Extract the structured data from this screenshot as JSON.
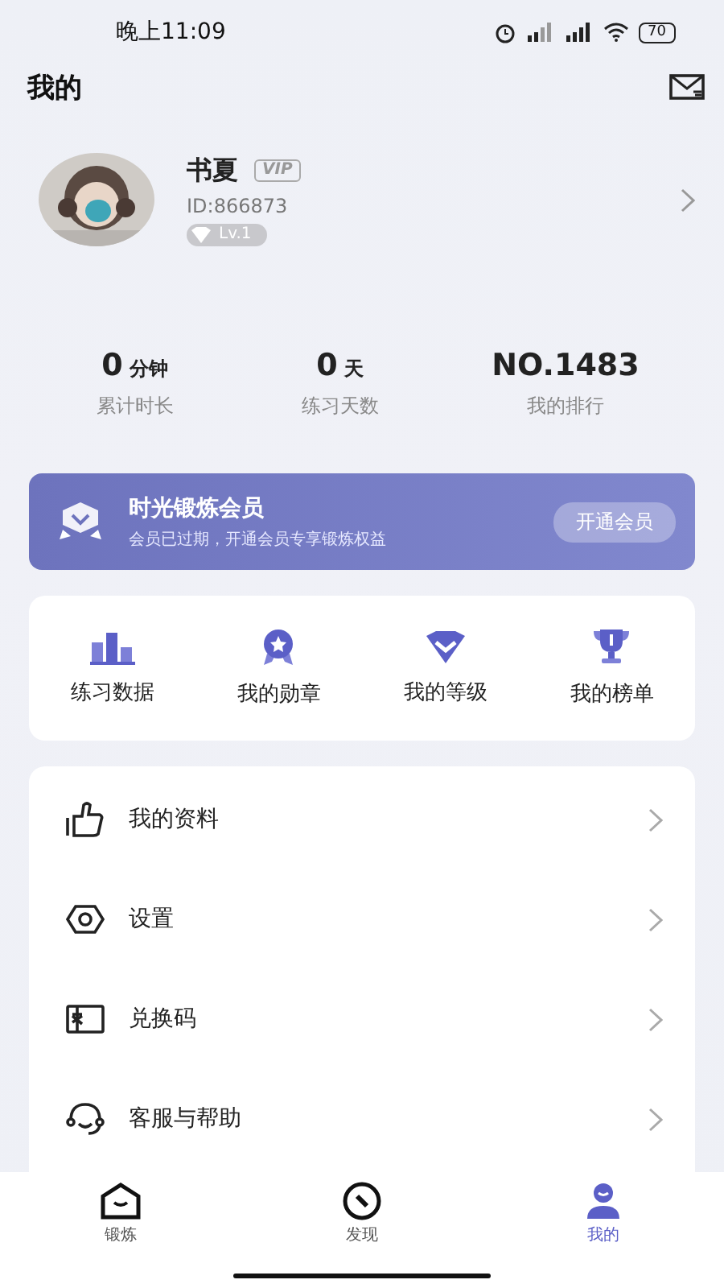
{
  "status_bar": {
    "time": "晚上11:09",
    "battery": "70"
  },
  "header": {
    "title": "我的"
  },
  "profile": {
    "name": "书夏",
    "vip_badge": "VIP",
    "id": "ID:866873",
    "level": "Lv.1"
  },
  "stats": [
    {
      "value": "0",
      "unit": "分钟",
      "label": "累计时长"
    },
    {
      "value": "0",
      "unit": "天",
      "label": "练习天数"
    },
    {
      "value": "NO.1483",
      "label": "我的排行"
    }
  ],
  "membership": {
    "title": "时光锻炼会员",
    "subtitle": "会员已过期，开通会员专享锻炼权益",
    "button": "开通会员"
  },
  "quick_links": [
    {
      "kind": "chart",
      "label": "练习数据"
    },
    {
      "kind": "medal",
      "label": "我的勋章"
    },
    {
      "kind": "diamond",
      "label": "我的等级"
    },
    {
      "kind": "trophy",
      "label": "我的榜单"
    }
  ],
  "menu": [
    {
      "kind": "thumb",
      "label": "我的资料"
    },
    {
      "kind": "hex",
      "label": "设置"
    },
    {
      "kind": "code",
      "label": "兑换码"
    },
    {
      "kind": "headset",
      "label": "客服与帮助"
    }
  ],
  "tabs": [
    {
      "kind": "home",
      "label": "锻炼",
      "selected": false
    },
    {
      "kind": "compass",
      "label": "发现",
      "selected": false
    },
    {
      "kind": "user",
      "label": "我的",
      "selected": true
    }
  ]
}
